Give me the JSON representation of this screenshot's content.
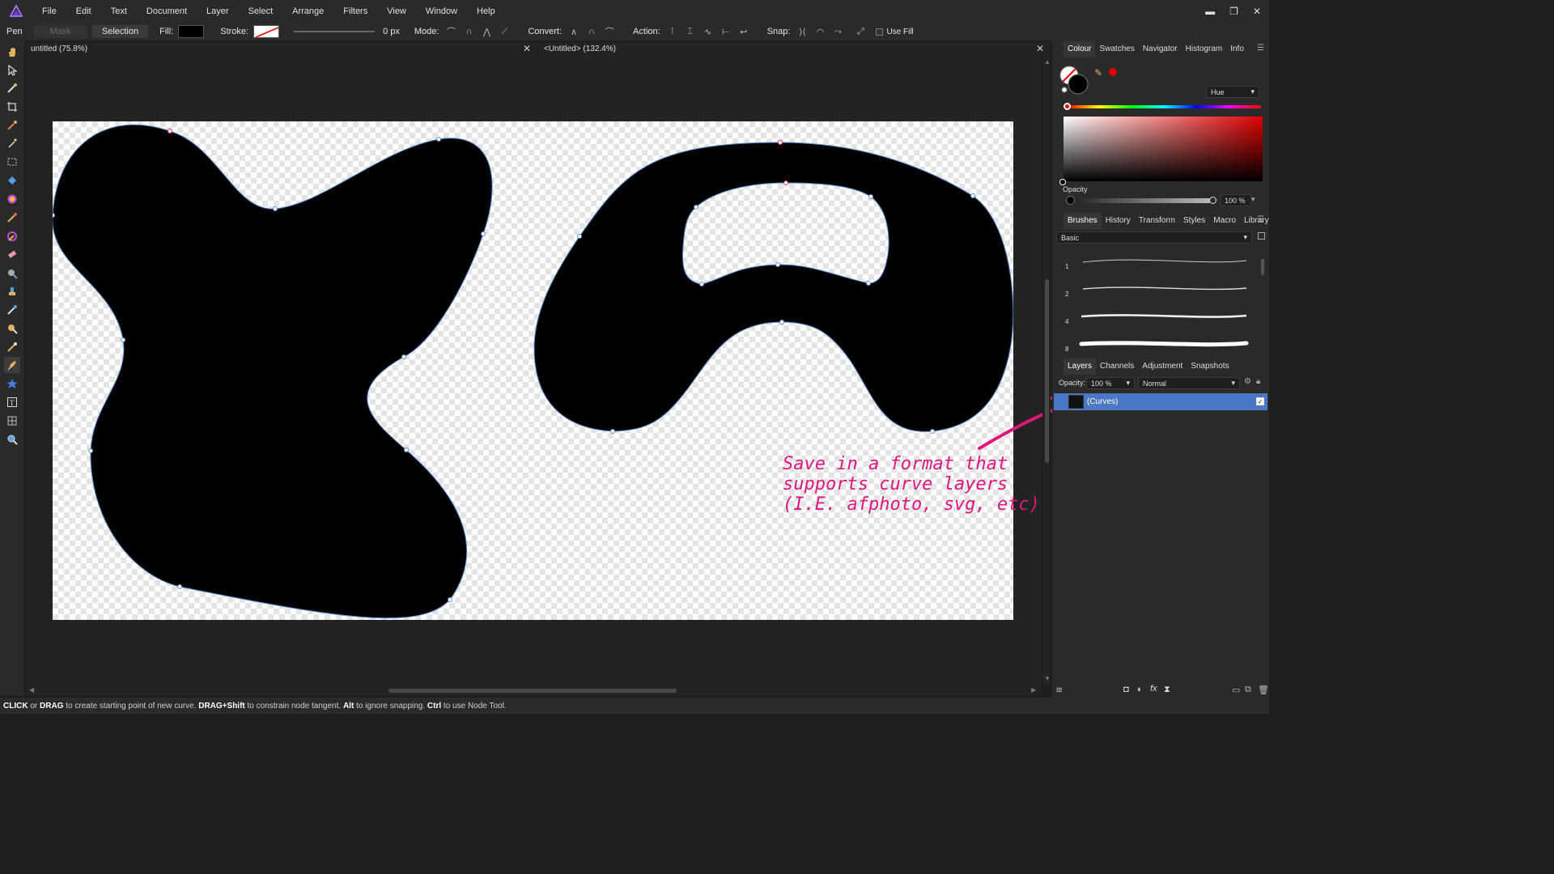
{
  "menubar": {
    "items": [
      "File",
      "Edit",
      "Text",
      "Document",
      "Layer",
      "Select",
      "Arrange",
      "Filters",
      "View",
      "Window",
      "Help"
    ],
    "win_min": "▬",
    "win_restore": "❐",
    "win_close": "✕"
  },
  "context": {
    "tool_name": "Pen",
    "mask_label": "Mask",
    "selection_label": "Selection",
    "fill_label": "Fill:",
    "stroke_label": "Stroke:",
    "width_value": "0 px",
    "mode_label": "Mode:",
    "convert_label": "Convert:",
    "action_label": "Action:",
    "snap_label": "Snap:",
    "use_fill_label": "Use Fill",
    "fill_color": "#000000"
  },
  "tabs": {
    "doc1_title": "untitled (75.8%)",
    "doc2_title": "<Untitled> (132.4%)",
    "close": "✕"
  },
  "colour_panel": {
    "tabs": [
      "Colour",
      "Swatches",
      "Navigator",
      "Histogram",
      "Info"
    ],
    "model": "Hue",
    "opacity_label": "Opacity",
    "opacity_value": "100 %",
    "accent": "#e00000"
  },
  "brushes_panel": {
    "tabs": [
      "Brushes",
      "History",
      "Transform",
      "Styles",
      "Macro",
      "Library"
    ],
    "category": "Basic",
    "sizes": [
      "1",
      "2",
      "4",
      "8"
    ]
  },
  "layers_panel": {
    "tabs": [
      "Layers",
      "Channels",
      "Adjustment",
      "Snapshots"
    ],
    "opacity_label": "Opacity:",
    "opacity_value": "100 %",
    "blend_mode": "Normal",
    "layer_name": "(Curves)",
    "selected_color": "#4a78c4"
  },
  "annotation": {
    "line1": "Save in a format that",
    "line2": "supports curve layers",
    "line3": "(I.E. afphoto, svg, etc)",
    "color": "#e0157d"
  },
  "status": {
    "p1": "CLICK",
    "p2": " or ",
    "p3": "DRAG",
    "p4": " to create starting point of new curve. ",
    "p5": "DRAG+Shift",
    "p6": " to constrain node tangent. ",
    "p7": "Alt",
    "p8": " to ignore snapping. ",
    "p9": "Ctrl",
    "p10": " to use Node Tool."
  }
}
